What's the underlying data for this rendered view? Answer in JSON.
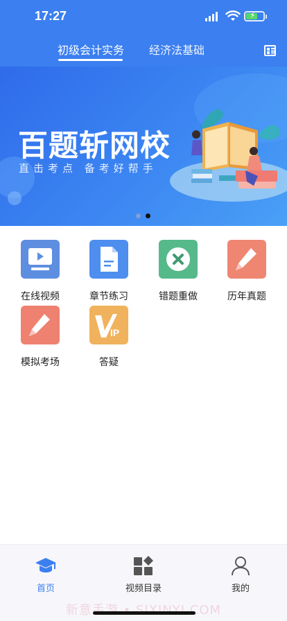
{
  "status_bar": {
    "time": "17:27",
    "icons": [
      "signal-icon",
      "wifi-icon",
      "battery-charging-icon"
    ]
  },
  "header": {
    "tabs": [
      {
        "label": "初级会计实务",
        "active": true
      },
      {
        "label": "经济法基础",
        "active": false
      }
    ],
    "menu_icon": "grid-list-icon",
    "color": "#3b7ff0"
  },
  "banner": {
    "title": "百题斩网校",
    "subtitle": "直击考点  备考好帮手",
    "slide_count": 2,
    "active_slide": 2
  },
  "menu": {
    "items": [
      {
        "label": "在线视频",
        "icon": "video-play-icon",
        "color": "#5d8ee0"
      },
      {
        "label": "章节练习",
        "icon": "document-icon",
        "color": "#4d8eef"
      },
      {
        "label": "错题重做",
        "icon": "wrong-x-icon",
        "color": "#56b98a"
      },
      {
        "label": "历年真题",
        "icon": "pencil-icon",
        "color": "#ef8672"
      },
      {
        "label": "模拟考场",
        "icon": "pencil-icon",
        "color": "#ee8170"
      },
      {
        "label": "答疑",
        "icon": "vip-icon",
        "color": "#f0b25c"
      }
    ]
  },
  "bottom_nav": {
    "items": [
      {
        "label": "首页",
        "icon": "graduation-cap-icon",
        "active": true
      },
      {
        "label": "视频目录",
        "icon": "catalog-grid-icon",
        "active": false
      },
      {
        "label": "我的",
        "icon": "user-icon",
        "active": false
      }
    ],
    "active_color": "#3b7ff0"
  },
  "watermark": "新意手游 • SIXINYI.COM"
}
